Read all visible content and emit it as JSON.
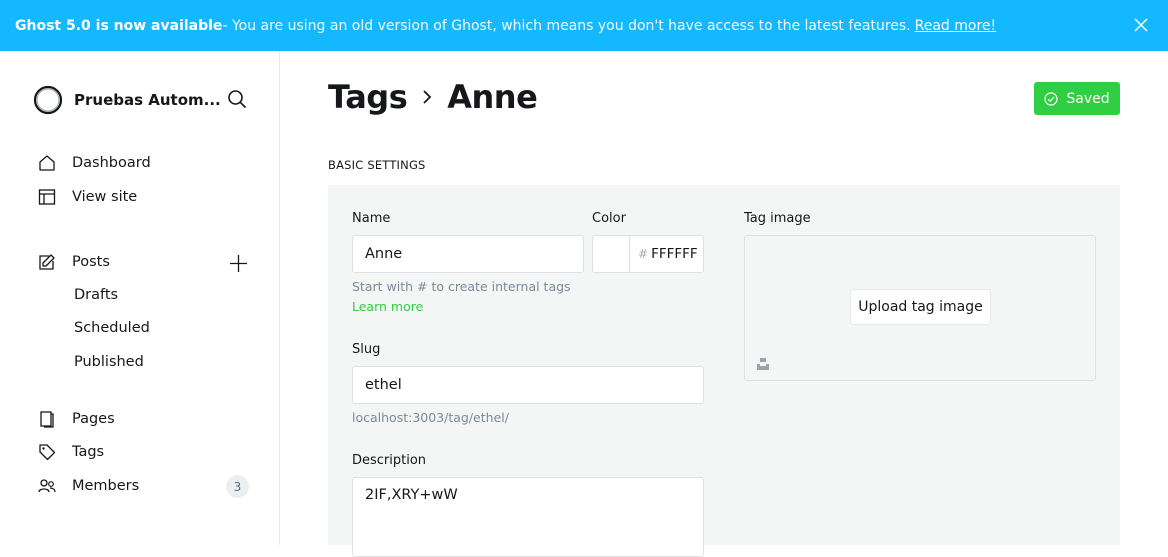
{
  "banner": {
    "headline": "Ghost 5.0 is now available",
    "message": " - You are using an old version of Ghost, which means you don't have access to the latest features.",
    "link": "Read more!"
  },
  "sidebar": {
    "site_name": "Pruebas Autom...",
    "nav": {
      "dashboard": "Dashboard",
      "view_site": "View site",
      "posts": "Posts",
      "drafts": "Drafts",
      "scheduled": "Scheduled",
      "published": "Published",
      "pages": "Pages",
      "tags": "Tags",
      "members": "Members",
      "members_count": "3"
    }
  },
  "header": {
    "breadcrumb": "Tags",
    "title": "Anne",
    "saved_label": "Saved"
  },
  "form": {
    "section_label": "BASIC SETTINGS",
    "name_label": "Name",
    "name_value": "Anne",
    "name_hint": "Start with # to create internal tags",
    "learn_more": "Learn more",
    "color_label": "Color",
    "color_hash": "#",
    "color_value": "FFFFFF",
    "slug_label": "Slug",
    "slug_value": "ethel",
    "slug_url": "localhost:3003/tag/ethel/",
    "description_label": "Description",
    "description_value": "2IF,XRY+wW",
    "tag_image_label": "Tag image",
    "upload_label": "Upload tag image"
  },
  "colors": {
    "banner": "#14b8ff",
    "saved": "#30cf43",
    "panel": "#f4f5f5",
    "link_green": "#30cf43"
  }
}
